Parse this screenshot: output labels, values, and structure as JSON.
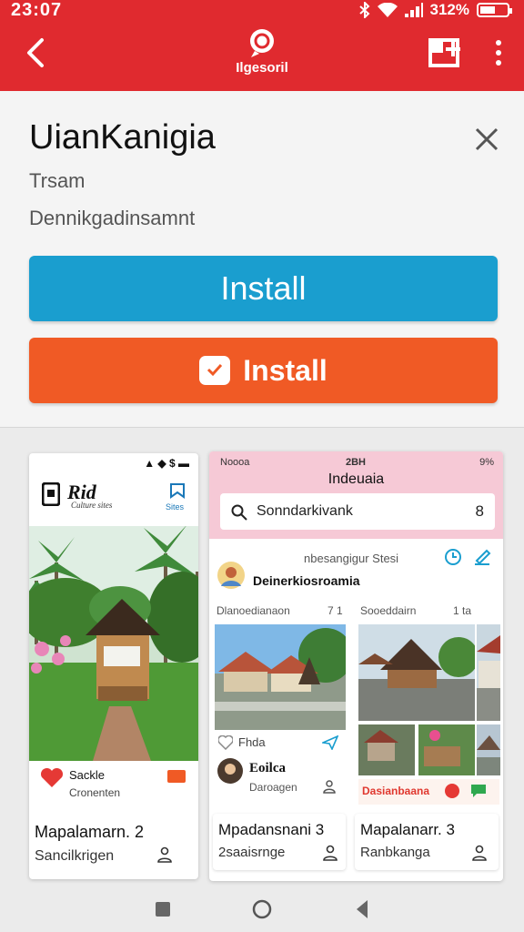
{
  "status": {
    "time": "23:07",
    "battery": "312%"
  },
  "appbar": {
    "brand": "Ilgesoril"
  },
  "card": {
    "app_name": "UianKanigia",
    "developer": "Trsam",
    "subtitle": "Dennikgadinsamnt",
    "install_label": "Install",
    "install_label_2": "Install"
  },
  "shot1": {
    "status_time": "",
    "header_title": "Rid",
    "header_sub": "Culture sites",
    "header_action": "Sites",
    "caption_title": "Sackle",
    "caption_sub": "Cronenten",
    "tile_title": "Mapalamarn. 2",
    "tile_sub": "Sancilkrigen"
  },
  "shot2": {
    "status_time": "Noooa",
    "status_center": "2BH",
    "status_right": "9%",
    "title": "Indeuaia",
    "search_text": "Sonndarkivank",
    "search_count": "8",
    "meta_line": "nbesangigur Stesi",
    "profile_name": "Deinerkiosroamia",
    "col1_label": "Dlanoedianaon",
    "col1_count": "7 1",
    "col2_label": "Sooeddairn",
    "col2_count": "1 ta",
    "like_label": "Fhda",
    "avatar_name": "Eoilca",
    "avatar_sub": "Daroagen",
    "promo_text": "Dasianbaana",
    "tile2_title": "Mpadansnani 3",
    "tile2_sub": "2saaisrnge",
    "tile3_title": "Mapalanarr. 3",
    "tile3_sub": "Ranbkanga"
  },
  "colors": {
    "brand_red": "#e02a2f",
    "install_blue": "#1a9ecf",
    "install_orange": "#f05a25"
  }
}
